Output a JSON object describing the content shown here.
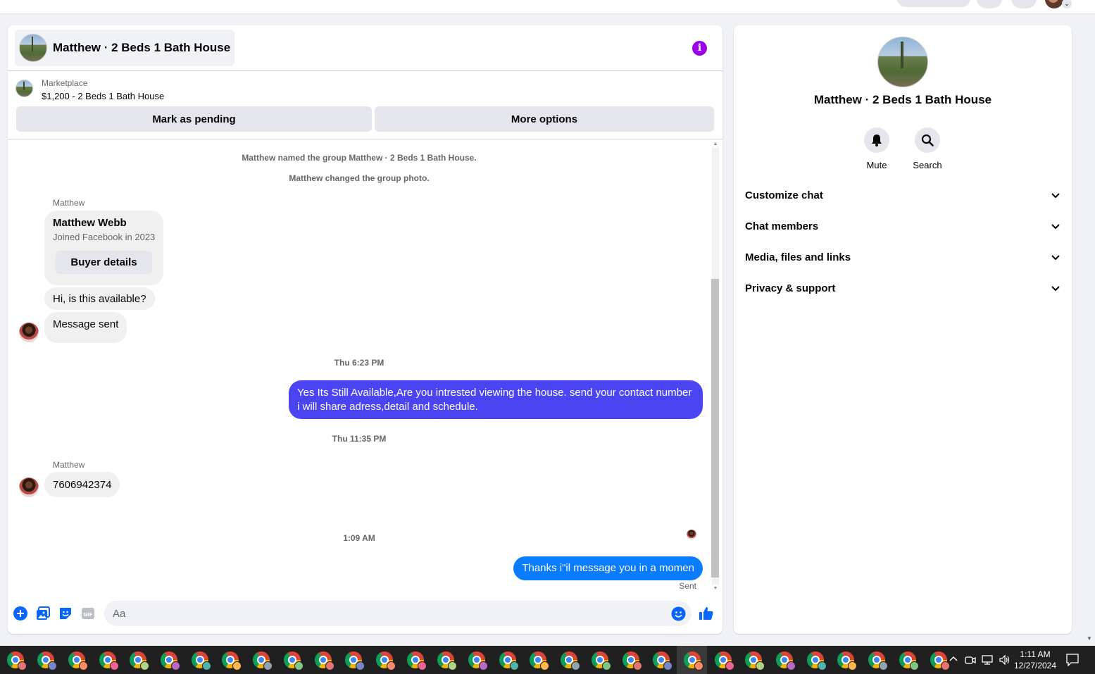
{
  "chat": {
    "title": "Matthew · 2 Beds 1 Bath House",
    "listing": {
      "label": "Marketplace",
      "price_title": "$1,200 - 2 Beds 1 Bath House"
    },
    "actions": {
      "mark_pending": "Mark as pending",
      "more_options": "More options"
    },
    "system_messages": [
      "Matthew named the group Matthew · 2 Beds 1 Bath House.",
      "Matthew changed the group photo."
    ],
    "sender_name": "Matthew",
    "profile_card": {
      "name": "Matthew Webb",
      "subtitle": "Joined Facebook in 2023",
      "button": "Buyer details"
    },
    "messages": {
      "m1": "Hi, is this available?",
      "m2": "Message sent",
      "ts1": "Thu 6:23 PM",
      "m3": "Yes Its Still Available,Are you intrested viewing the house. send your contact number i will share adress,detail and schedule.",
      "ts2": "Thu 11:35 PM",
      "m4": "7606942374",
      "ts3": "1:09 AM",
      "m5": "Thanks i\"il message you in a momen",
      "status": "Sent"
    },
    "composer": {
      "placeholder": "Aa"
    },
    "colors": {
      "out_bubble_purple": "#4a44f2",
      "out_bubble_blue": "#0a7cff",
      "accent": "#0866ff",
      "info": "#9b00e8"
    }
  },
  "info_panel": {
    "title": "Matthew · 2 Beds 1 Bath House",
    "quick_actions": {
      "mute": "Mute",
      "search": "Search"
    },
    "sections": [
      "Customize chat",
      "Chat members",
      "Media, files and links",
      "Privacy & support"
    ]
  },
  "taskbar": {
    "time": "1:11 AM",
    "date": "12/27/2024",
    "app_count": 31
  }
}
